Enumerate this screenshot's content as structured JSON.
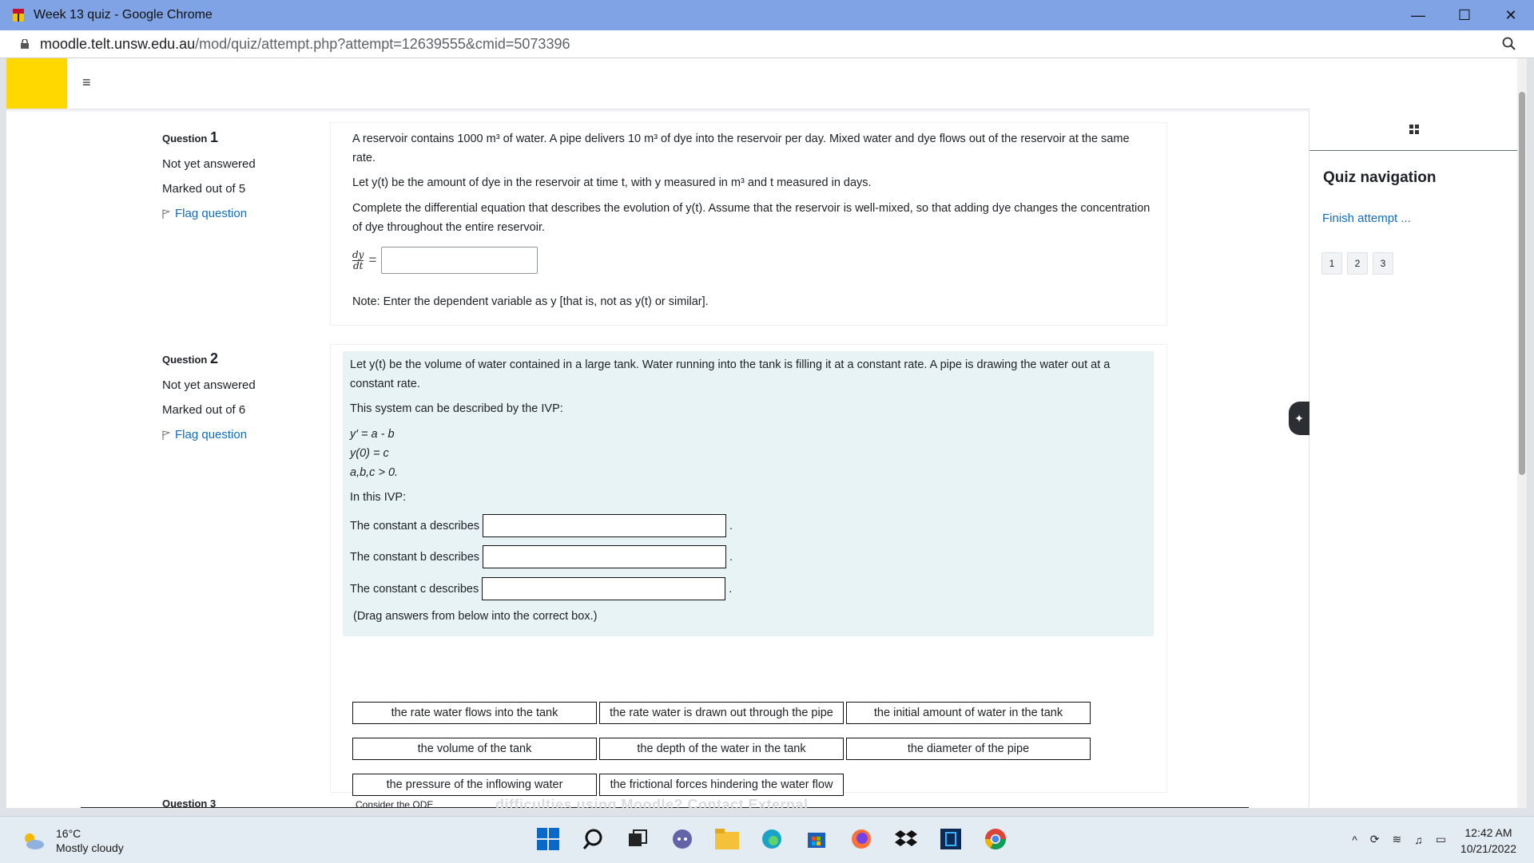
{
  "window": {
    "title": "Week 13 quiz - Google Chrome",
    "controls": {
      "minimize": "—",
      "maximize": "☐",
      "close": "✕"
    }
  },
  "address_bar": {
    "host": "moodle.telt.unsw.edu.au",
    "path": "/mod/quiz/attempt.php?attempt=12639555&cmid=5073396"
  },
  "colors": {
    "brand_yellow": "#ffd800",
    "link_blue": "#0f6cbf",
    "chrome_titlebar": "#7fa3e4"
  },
  "q1": {
    "label": "Question",
    "number": "1",
    "status": "Not yet answered",
    "marks": "Marked out of 5",
    "flag": "Flag question",
    "p1": "A reservoir contains 1000 m³ of water.  A pipe delivers 10 m³ of dye into the reservoir per day.  Mixed water and dye flows out of the reservoir at the same rate.",
    "p2": "Let y(t) be the amount of dye in the reservoir at time t, with y measured in m³ and t measured in days.",
    "p3": "Complete the differential equation that describes the evolution of y(t).  Assume that the reservoir is well-mixed, so that adding dye changes the concentration of dye throughout the entire reservoir.",
    "deriv_num": "dy",
    "deriv_den": "dt",
    "equals": "=",
    "answer_value": "",
    "note": "Note: Enter the dependent variable as y [that is, not as y(t) or similar]."
  },
  "q2": {
    "label": "Question",
    "number": "2",
    "status": "Not yet answered",
    "marks": "Marked out of 6",
    "flag": "Flag question",
    "p1": "Let y(t) be the volume of water contained in a large tank.  Water running into the tank is filling it at a constant rate.  A pipe is drawing the water out at a constant rate.",
    "p2": "This system can be described by the IVP:",
    "eq1": "y′ = a - b",
    "eq2": "y(0) = c",
    "eq3": "a,b,c > 0.",
    "p3": "In this IVP:",
    "const_a": "The constant a describes",
    "const_b": "The constant b describes",
    "const_c": "The constant c describes",
    "period": ".",
    "drag_hint": "(Drag answers from below into the correct box.)",
    "options": [
      "the rate water flows into the tank",
      "the rate water is drawn out through the pipe",
      "the initial amount of water in the tank",
      "the volume of the tank",
      "the depth of the water in the tank",
      "the diameter of the pipe",
      "the pressure of the inflowing water",
      "the frictional forces hindering the water flow"
    ]
  },
  "q3_peek": {
    "label": "Question 3",
    "text": "Consider the ODE",
    "footer": "difficulties using Moodle? Contact External"
  },
  "quiz_nav": {
    "title": "Quiz navigation",
    "finish": "Finish attempt ...",
    "buttons": [
      "1",
      "2",
      "3"
    ]
  },
  "taskbar": {
    "temp": "16°C",
    "condition": "Mostly cloudy",
    "time": "12:42 AM",
    "date": "10/21/2022"
  }
}
